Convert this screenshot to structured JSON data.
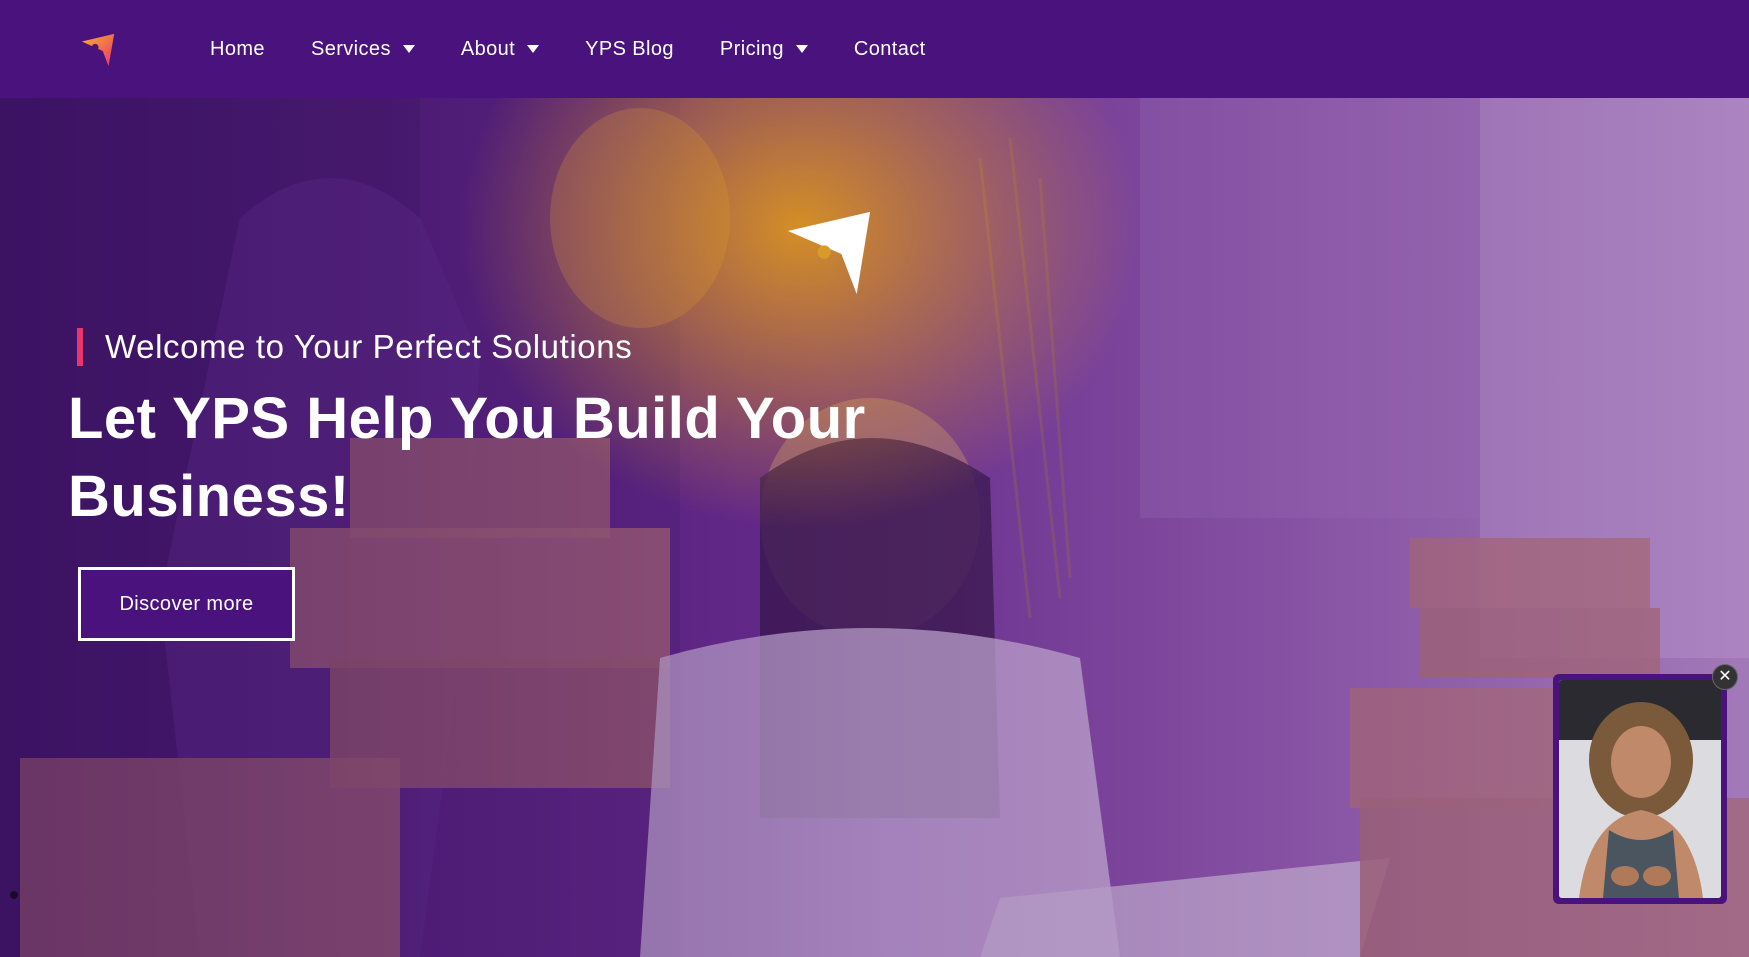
{
  "nav": {
    "logo_icon": "yps-arrow-logo-icon",
    "items": [
      {
        "label": "Home",
        "has_dropdown": false
      },
      {
        "label": "Services",
        "has_dropdown": true
      },
      {
        "label": "About",
        "has_dropdown": true
      },
      {
        "label": "YPS Blog",
        "has_dropdown": false
      },
      {
        "label": "Pricing",
        "has_dropdown": true
      },
      {
        "label": "Contact",
        "has_dropdown": false
      }
    ]
  },
  "hero": {
    "tagline": "Welcome to Your Perfect Solutions",
    "headline_line1": "Let YPS Help You Build Your",
    "headline_line2": "Business!",
    "cta_label": "Discover more"
  },
  "video_popup": {
    "close_icon": "close-icon"
  },
  "colors": {
    "nav_bg": "#4a127c",
    "accent_bar": "#e8356b",
    "logo_orange": "#f5a623",
    "logo_red": "#e8356b",
    "text": "#ffffff"
  }
}
